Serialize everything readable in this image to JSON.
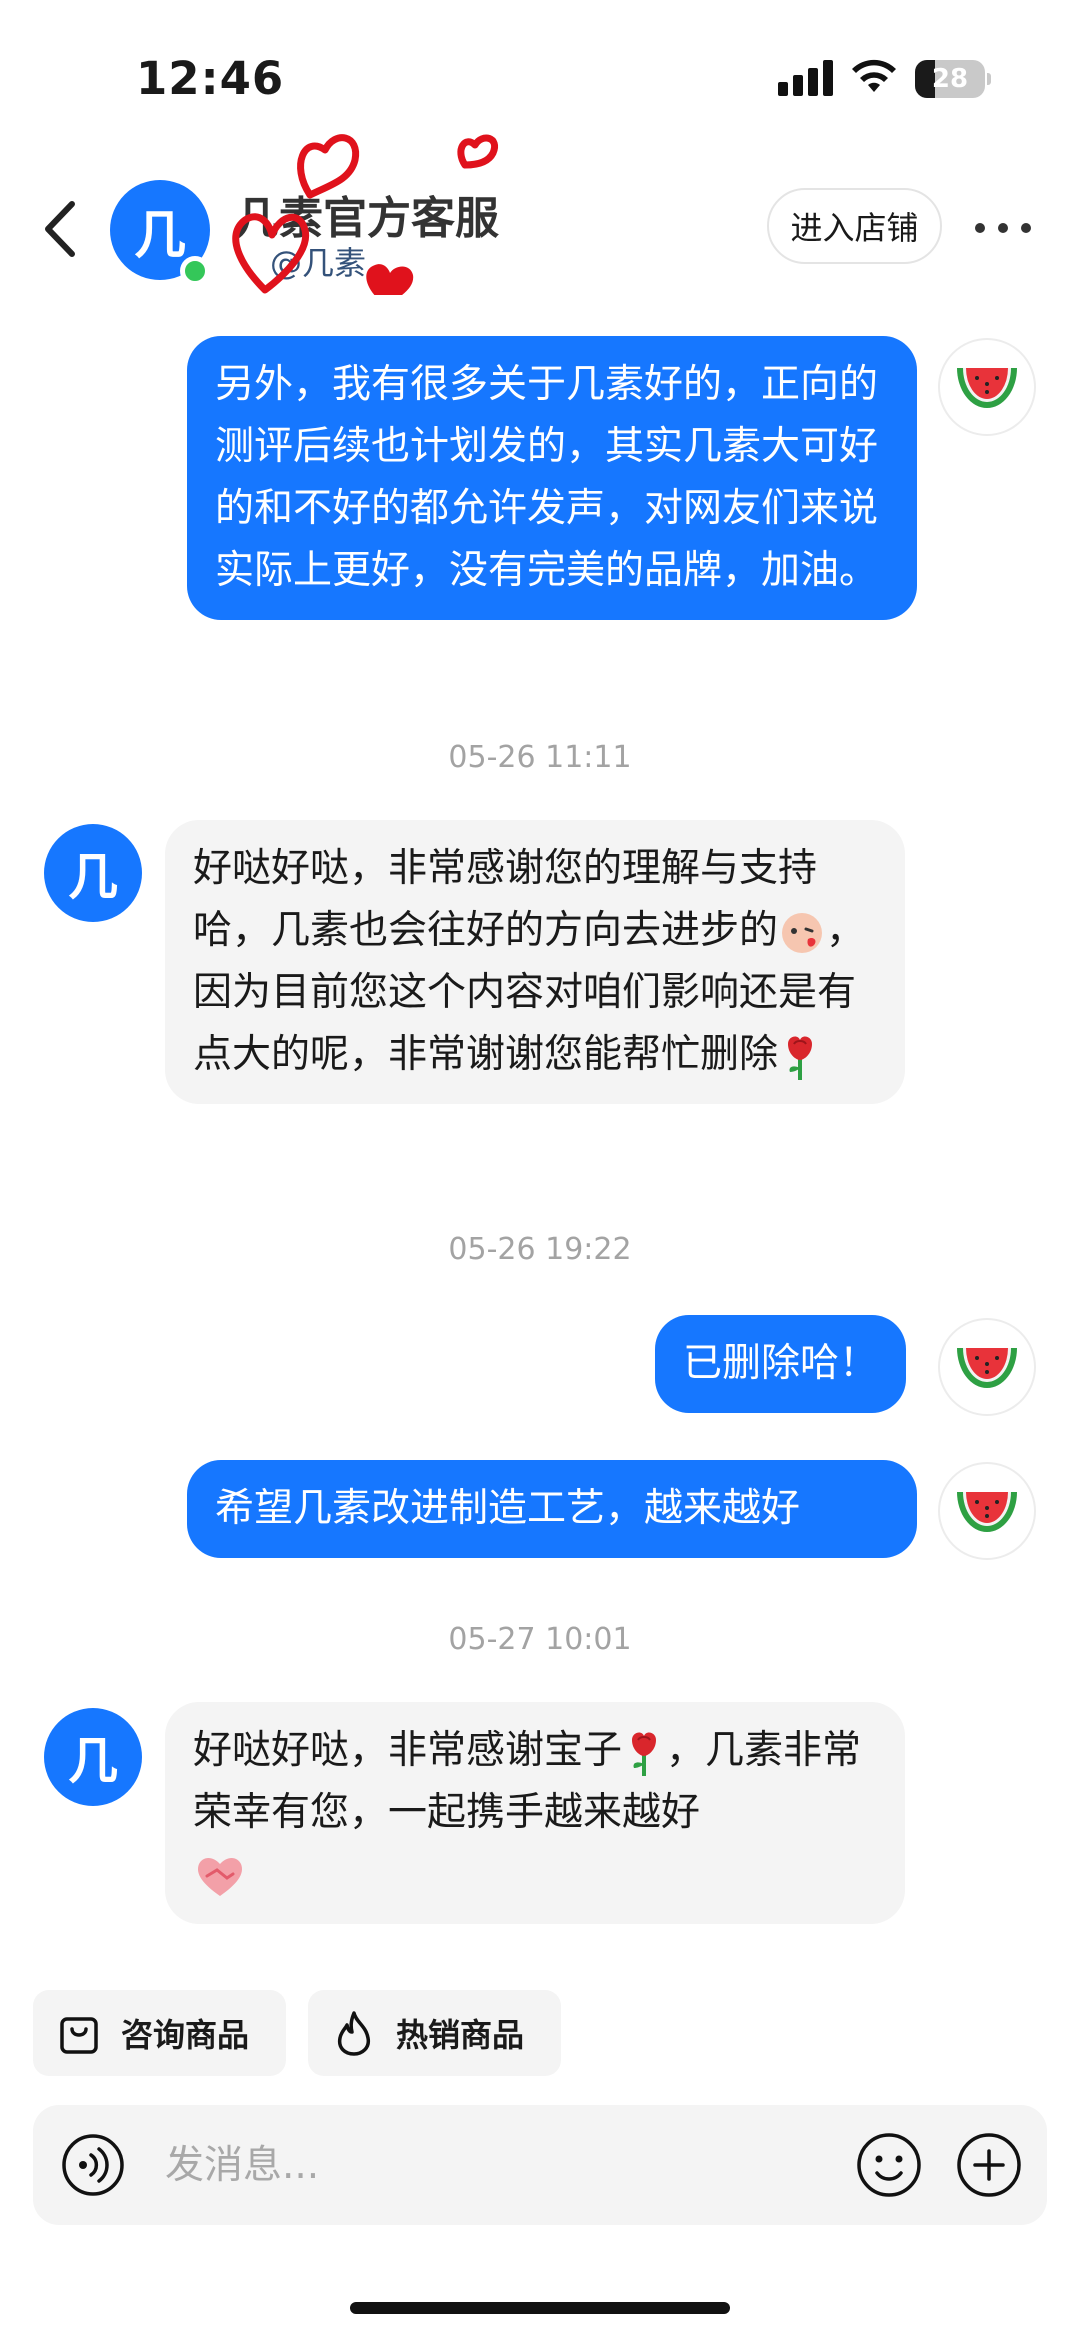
{
  "status_bar": {
    "time": "12:46",
    "battery_text": "28",
    "battery_level": 0.28
  },
  "header": {
    "title": "几素官方客服",
    "subtitle": "@几素",
    "shop_button": "进入店铺",
    "avatar_glyph": "几"
  },
  "messages": [
    {
      "sender": "me",
      "text": "另外，我有很多关于几素好的，正向的测评后续也计划发的，其实几素大可好的和不好的都允许发声，对网友们来说实际上更好，没有完美的品牌，加油。"
    },
    {
      "sender": "timestamp",
      "text": "05-26 11:11"
    },
    {
      "sender": "them",
      "text_1": "好哒好哒，非常感谢您的理解与支持哈，几素也会往好的方向去进步的",
      "text_2": "，因为目前您这个内容对咱们影响还是有点大的呢，非常谢谢您能帮忙删除"
    },
    {
      "sender": "timestamp",
      "text": "05-26 19:22"
    },
    {
      "sender": "me",
      "text": "已删除哈！"
    },
    {
      "sender": "me",
      "text": "希望几素改进制造工艺，越来越好"
    },
    {
      "sender": "timestamp",
      "text": "05-27 10:01"
    },
    {
      "sender": "them",
      "text_1": "好哒好哒，非常感谢宝子",
      "text_2": "，几素非常荣幸有您，一起携手越来越好"
    }
  ],
  "quick_actions": [
    {
      "label": "咨询商品",
      "icon": "shopping-bag-icon"
    },
    {
      "label": "热销商品",
      "icon": "flame-icon"
    }
  ],
  "input": {
    "placeholder": "发消息..."
  },
  "colors": {
    "accent": "#1677ff",
    "bubble_other": "#f4f4f4",
    "online": "#34c759",
    "doodle": "#e0121c"
  }
}
